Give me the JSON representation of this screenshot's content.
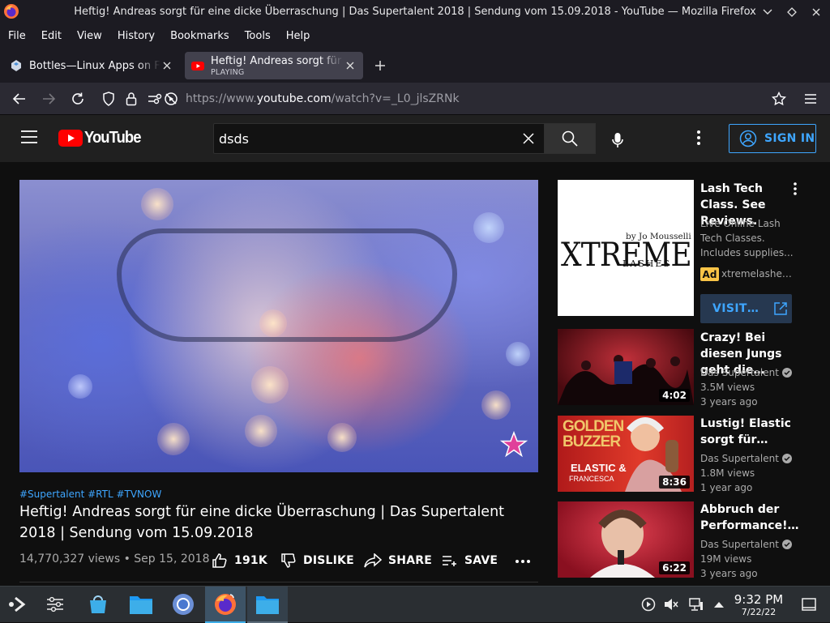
{
  "window": {
    "title": "Heftig! Andreas sorgt für eine dicke Überraschung | Das Supertalent 2018 | Sendung vom 15.09.2018 - YouTube — Mozilla Firefox"
  },
  "menubar": {
    "file": "File",
    "edit": "Edit",
    "view": "View",
    "history": "History",
    "bookmarks": "Bookmarks",
    "tools": "Tools",
    "help": "Help"
  },
  "tabs": [
    {
      "label": "Bottles—Linux Apps on Flathub",
      "sublabel": ""
    },
    {
      "label": "Heftig! Andreas sorgt für eine dicke",
      "sublabel": "PLAYING"
    }
  ],
  "navbar": {
    "url_scheme": "https://www.",
    "url_host": "youtube.com",
    "url_path": "/watch?v=_L0_jlsZRNk"
  },
  "youtube": {
    "logo_text": "YouTube",
    "search_value": "dsds",
    "sign_in_label": "SIGN IN"
  },
  "video": {
    "hashtags": "#Supertalent #RTL #TVNOW",
    "title": "Heftig! Andreas sorgt für eine dicke Überraschung | Das Supertalent 2018 | Sendung vom 15.09.2018",
    "views_date": "14,770,327 views • Sep 15, 2018",
    "likes": "191K",
    "dislike_label": "DISLIKE",
    "share_label": "SHARE",
    "save_label": "SAVE"
  },
  "ad": {
    "thumb_by": "by Jo Mousselli",
    "thumb_brand": "XTREME",
    "thumb_sub": "LASHES",
    "title": "Lash Tech Class. See Reviews.",
    "description": "Live Online Lash Tech Classes. Includes supplies...",
    "badge": "Ad",
    "domain": "xtremelashes.com",
    "visit_label": "VISIT…"
  },
  "recommended": [
    {
      "title": "Crazy! Bei diesen Jungs geht die…",
      "channel": "Das Supertalent",
      "views": "3.5M views",
      "age": "3 years ago",
      "duration": "4:02",
      "thumb_text": ""
    },
    {
      "title": "Lustig! Elastic sorgt für…",
      "channel": "Das Supertalent",
      "views": "1.8M views",
      "age": "1 year ago",
      "duration": "8:36",
      "thumb_text": "GOLDEN BUZZER",
      "thumb_sub": "ELASTIC &",
      "thumb_sub2": "FRANCESCA"
    },
    {
      "title": "Abbruch der Performance!…",
      "channel": "Das Supertalent",
      "views": "19M views",
      "age": "3 years ago",
      "duration": "6:22",
      "thumb_text": ""
    }
  ],
  "taskbar": {
    "time": "9:32 PM",
    "date": "7/22/22"
  },
  "colors": {
    "accent_blue": "#3ea6ff",
    "youtube_red": "#ff0000",
    "ad_badge": "#f9c447",
    "kde_highlight": "#3daee9"
  }
}
